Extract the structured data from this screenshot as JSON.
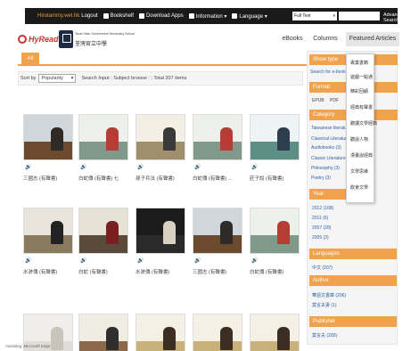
{
  "topbar": {
    "user": "Hirotammy.wel.hk",
    "logout": "Logout",
    "bookshelf": "Bookshelf",
    "download": "Download Apps",
    "information": "Information ▾",
    "language": "Language ▾",
    "search_scope": "Full Text",
    "advanced": "Advanced Search"
  },
  "header": {
    "logo": "HyRead",
    "school_en": "Tsuen Wan Government Secondary School",
    "school_zh": "荃灣官立中學",
    "nav": [
      "eBooks",
      "Columns",
      "Featured Articles"
    ]
  },
  "tabs": {
    "all": "All"
  },
  "sortbar": {
    "label": "Sort by",
    "selected": "Popularity",
    "info": "Search Input ; Subject browse : ; Total 207 items"
  },
  "books": [
    {
      "title": "三國志 (有聲書)",
      "cover": "temple"
    },
    {
      "title": "白蛇傳 (有聲書) 七",
      "cover": "snake"
    },
    {
      "title": "孫子兵法 (有聲書)",
      "cover": "sunzi"
    },
    {
      "title": "白蛇傳 (有聲書) ...",
      "cover": "snake"
    },
    {
      "title": "莊子說 (有聲書)",
      "cover": "zhuangzi"
    },
    {
      "title": "水滸傳 (有聲書)",
      "cover": "legend"
    },
    {
      "title": "白蛇 (有聲書)",
      "cover": "legend2"
    },
    {
      "title": "水滸傳 (有聲書)",
      "cover": "water"
    },
    {
      "title": "三國志 (有聲書)",
      "cover": "temple"
    },
    {
      "title": "白蛇傳 (有聲書)",
      "cover": "snake"
    },
    {
      "title": "",
      "cover": "plain"
    },
    {
      "title": "",
      "cover": "shanghai"
    },
    {
      "title": "",
      "cover": "fengshen"
    },
    {
      "title": "",
      "cover": "fengshen"
    },
    {
      "title": "",
      "cover": "fengshen"
    }
  ],
  "sidebar": {
    "show_type_head": "Show type",
    "show_type_link": "Search for e-book",
    "format_head": "Format",
    "format_options": [
      "EPUB",
      "PDF"
    ],
    "category_head": "Category",
    "category_items": [
      "Taiwanese literature (200)",
      "Classical Literature",
      "Audiobooks (3)",
      "Classic Literature",
      "Philosophy (3)",
      "Poetry (3)"
    ],
    "year_head": "Year",
    "years": [
      "2012 (168)",
      "2011 (6)",
      "2007 (28)",
      "2005 (3)"
    ],
    "languages_head": "Languages",
    "languages": [
      "中文 (207)"
    ],
    "author_head": "Author",
    "authors": [
      "華語文書庫 (206)",
      "莫言夫妻 (1)"
    ],
    "publisher_head": "Publisher",
    "publishers": [
      "莫言夫 (200)"
    ]
  },
  "popup": {
    "items": [
      "專業書籍",
      "遊戲一點通",
      "精彩回顧",
      "經典有聲書",
      "聽讀文學經典",
      "聽說人物",
      "漫畫說經典",
      "文學思維",
      "飲食文學"
    ]
  },
  "status": "Assisting: Microsoft Edge"
}
